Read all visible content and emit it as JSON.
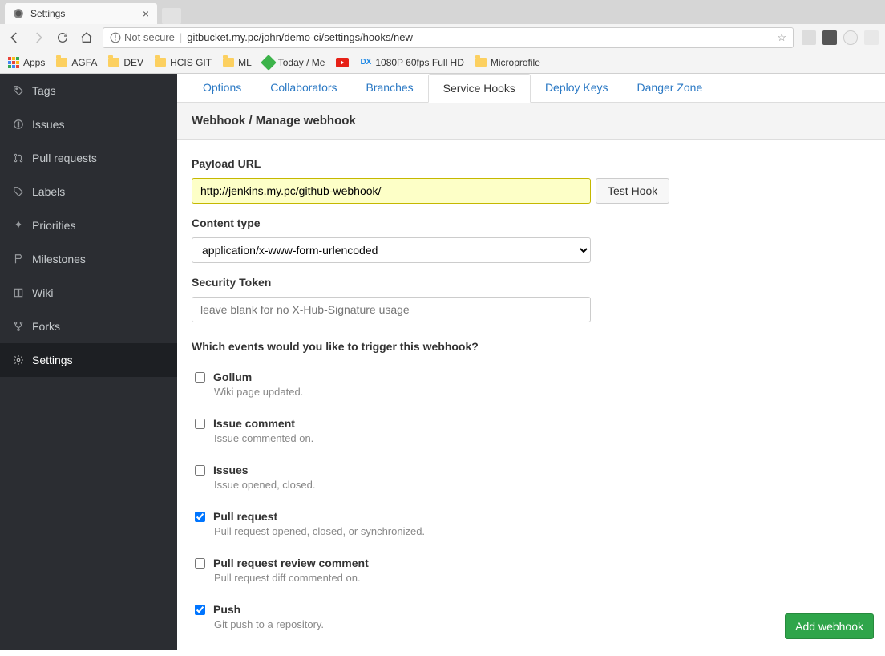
{
  "browser": {
    "tab_title": "Settings",
    "url_secure": "Not secure",
    "url": "gitbucket.my.pc/john/demo-ci/settings/hooks/new",
    "bookmarks": {
      "apps": "Apps",
      "items": [
        "AGFA",
        "DEV",
        "HCIS GIT",
        "ML",
        "Today / Me",
        "",
        "1080P 60fps Full HD",
        "",
        "Microprofile"
      ]
    }
  },
  "sidebar": {
    "items": [
      {
        "label": "Tags"
      },
      {
        "label": "Issues"
      },
      {
        "label": "Pull requests"
      },
      {
        "label": "Labels"
      },
      {
        "label": "Priorities"
      },
      {
        "label": "Milestones"
      },
      {
        "label": "Wiki"
      },
      {
        "label": "Forks"
      },
      {
        "label": "Settings"
      }
    ],
    "active_index": 8
  },
  "tabs": {
    "items": [
      "Options",
      "Collaborators",
      "Branches",
      "Service Hooks",
      "Deploy Keys",
      "Danger Zone"
    ],
    "active_index": 3
  },
  "panel": {
    "title": "Webhook / Manage webhook"
  },
  "form": {
    "payload_label": "Payload URL",
    "payload_value": "http://jenkins.my.pc/github-webhook/",
    "test_hook": "Test Hook",
    "content_type_label": "Content type",
    "content_type_value": "application/x-www-form-urlencoded",
    "token_label": "Security Token",
    "token_value": "",
    "token_placeholder": "leave blank for no X-Hub-Signature usage",
    "events_question": "Which events would you like to trigger this webhook?",
    "events": [
      {
        "name": "Gollum",
        "desc": "Wiki page updated.",
        "checked": false
      },
      {
        "name": "Issue comment",
        "desc": "Issue commented on.",
        "checked": false
      },
      {
        "name": "Issues",
        "desc": "Issue opened, closed.",
        "checked": false
      },
      {
        "name": "Pull request",
        "desc": "Pull request opened, closed, or synchronized.",
        "checked": true
      },
      {
        "name": "Pull request review comment",
        "desc": "Pull request diff commented on.",
        "checked": false
      },
      {
        "name": "Push",
        "desc": "Git push to a repository.",
        "checked": true
      }
    ],
    "add_button": "Add webhook"
  }
}
